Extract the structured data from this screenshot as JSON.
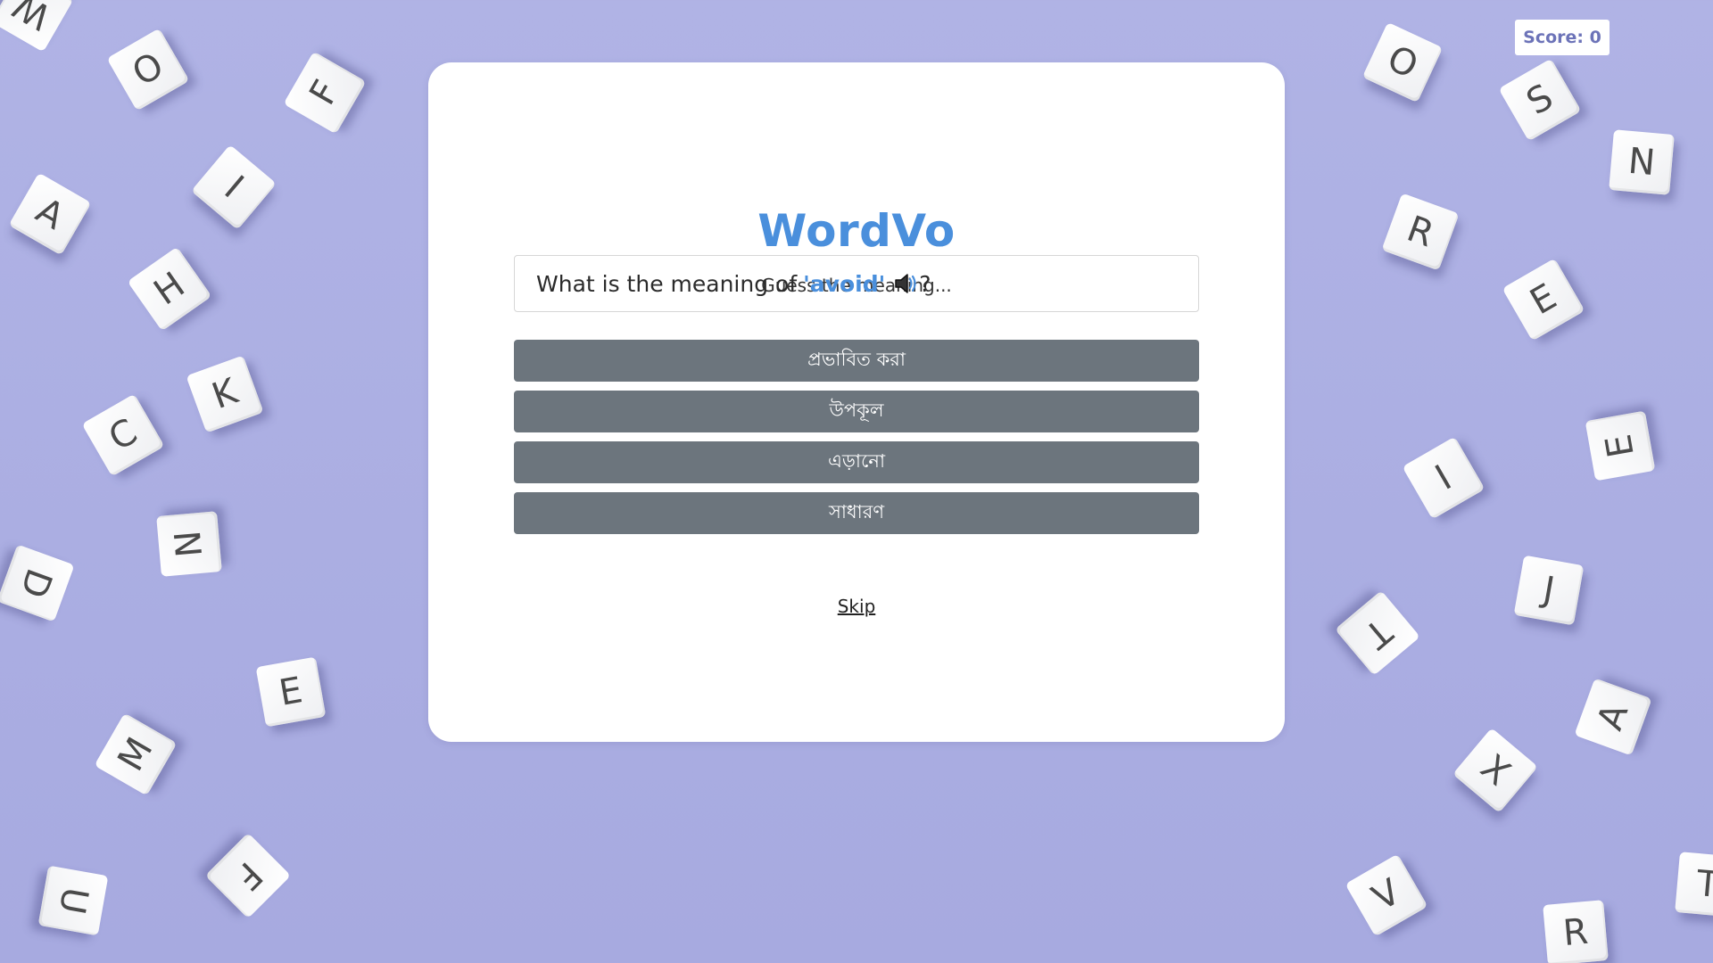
{
  "score": {
    "label": "Score: 0"
  },
  "app": {
    "title": "WordVo",
    "subtitle": "Guess the meaning..."
  },
  "question": {
    "prefix": "What is the meaning of",
    "word": "'avoid'",
    "suffix": "?",
    "audio_icon": "speaker-icon"
  },
  "options": [
    {
      "label": "প্রভাবিত করা"
    },
    {
      "label": "উপকূল"
    },
    {
      "label": "এড়ানো"
    },
    {
      "label": "সাধারণ"
    }
  ],
  "skip": {
    "label": "Skip"
  },
  "background_tiles": [
    "W",
    "O",
    "F",
    "A",
    "I",
    "H",
    "K",
    "C",
    "N",
    "D",
    "E",
    "M",
    "F",
    "U",
    "O",
    "S",
    "N",
    "R",
    "E",
    "E",
    "I",
    "J",
    "T",
    "A",
    "X",
    "V",
    "R",
    "T"
  ],
  "colors": {
    "accent": "#4a8fdc",
    "option_bg": "#6c757d",
    "background": "#aaaee2"
  }
}
